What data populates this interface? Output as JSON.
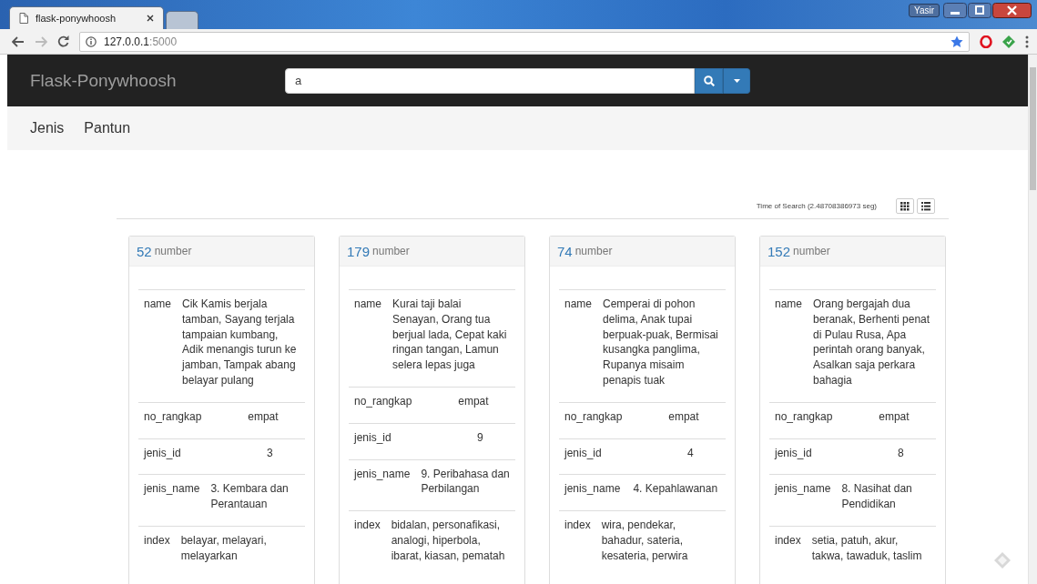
{
  "browser": {
    "tabs": [
      {
        "title": "flask-ponywhoosh",
        "selected": true
      },
      {
        "selected": false
      }
    ],
    "user": "Yasir",
    "address": {
      "host": "127.0.0.1",
      "port": ":5000"
    }
  },
  "navbar": {
    "brand": "Flask-Ponywhoosh",
    "search": {
      "value": "a"
    }
  },
  "menu": [
    "Jenis",
    "Pantun"
  ],
  "results": {
    "time": "Time of Search (2.48708386973 seg)",
    "views": [
      {
        "kind": "grid"
      },
      {
        "kind": "list"
      }
    ],
    "cards": [
      {
        "number": "52",
        "label": "number",
        "fields": [
          {
            "key": "name",
            "value": "Cik Kamis berjala tamban, Sayang terjala tampaian kumbang, Adik menangis turun ke jamban, Tampak abang belayar pulang"
          },
          {
            "key": "no_rangkap",
            "value": "empat"
          },
          {
            "key": "jenis_id",
            "value": "3"
          },
          {
            "key": "jenis_name",
            "value": "3. Kembara dan Perantauan"
          },
          {
            "key": "index",
            "value": "belayar, melayari, melayarkan"
          }
        ]
      },
      {
        "number": "179",
        "label": "number",
        "fields": [
          {
            "key": "name",
            "value": "Kurai taji balai Senayan, Orang tua berjual lada, Cepat kaki ringan tangan, Lamun selera lepas juga"
          },
          {
            "key": "no_rangkap",
            "value": "empat"
          },
          {
            "key": "jenis_id",
            "value": "9"
          },
          {
            "key": "jenis_name",
            "value": "9. Peribahasa dan Perbilangan"
          },
          {
            "key": "index",
            "value": "bidalan, personafikasi, analogi, hiperbola, ibarat, kiasan, pematah"
          }
        ]
      },
      {
        "number": "74",
        "label": "number",
        "fields": [
          {
            "key": "name",
            "value": "Cemperai di pohon delima, Anak tupai berpuak-puak, Bermisai kusangka panglima, Rupanya misaim penapis tuak"
          },
          {
            "key": "no_rangkap",
            "value": "empat"
          },
          {
            "key": "jenis_id",
            "value": "4"
          },
          {
            "key": "jenis_name",
            "value": "4. Kepahlawanan"
          },
          {
            "key": "index",
            "value": "wira, pendekar, bahadur, sateria, kesateria, perwira"
          }
        ]
      },
      {
        "number": "152",
        "label": "number",
        "fields": [
          {
            "key": "name",
            "value": "Orang bergajah dua beranak, Berhenti penat di Pulau Rusa, Apa perintah orang banyak, Asalkan saja perkara bahagia"
          },
          {
            "key": "no_rangkap",
            "value": "empat"
          },
          {
            "key": "jenis_id",
            "value": "8"
          },
          {
            "key": "jenis_name",
            "value": "8. Nasihat dan Pendidikan"
          },
          {
            "key": "index",
            "value": "setia, patuh, akur, takwa, tawaduk, taslim"
          }
        ]
      }
    ]
  }
}
